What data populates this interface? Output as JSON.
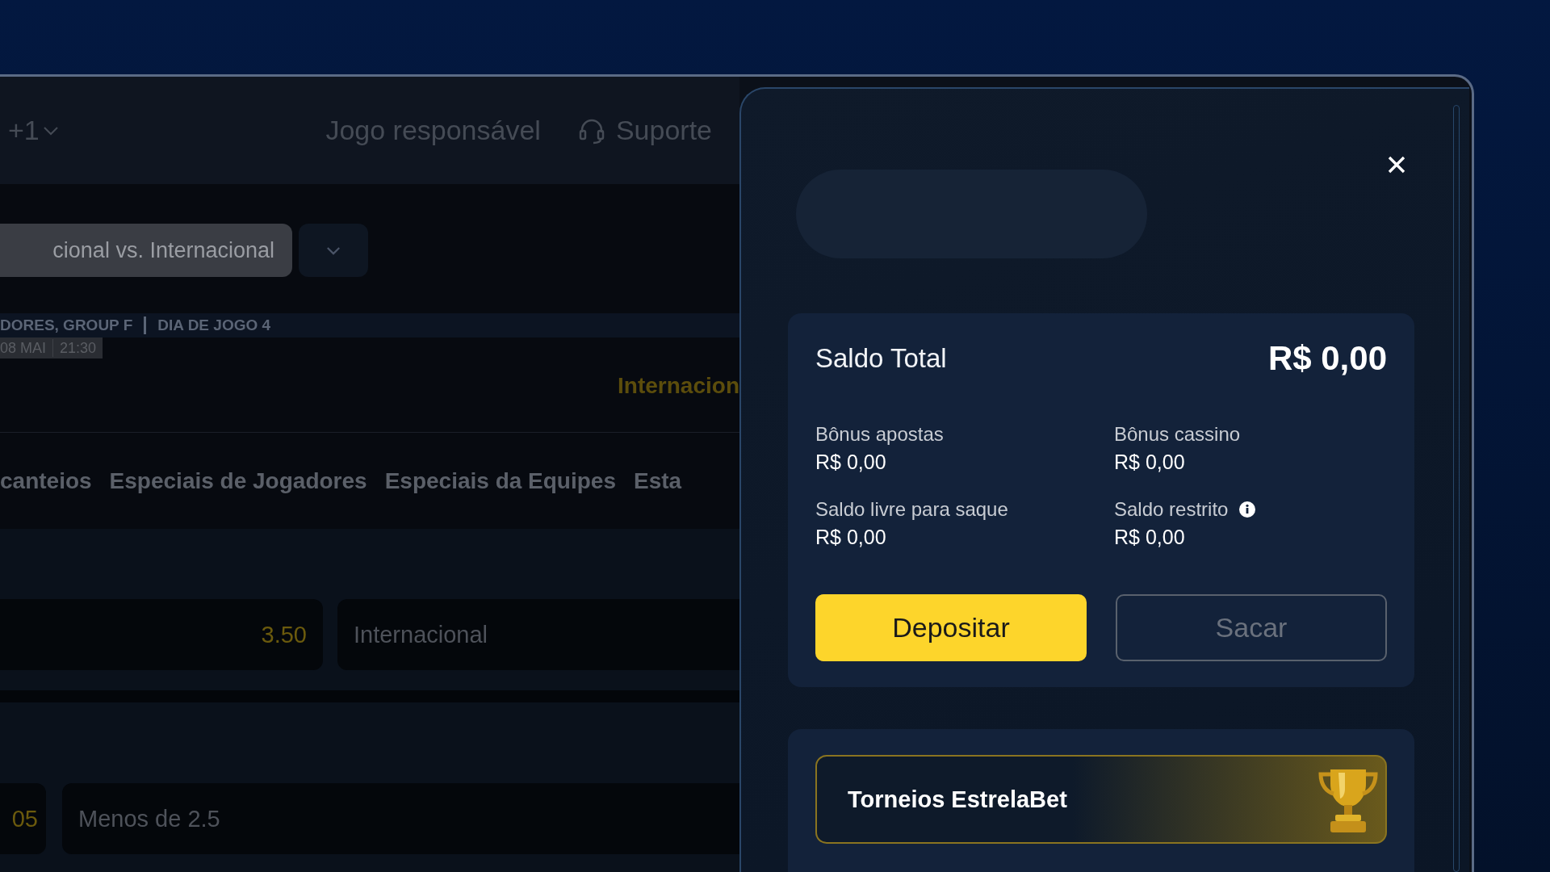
{
  "header": {
    "more_count": "+1",
    "links": [
      {
        "label": "Jogo responsável",
        "kind": "text"
      },
      {
        "label": "Suporte",
        "kind": "support"
      }
    ]
  },
  "match": {
    "selector": "cional vs. Internacional",
    "competition": "DORES, GROUP F",
    "matchday": "DIA DE JOGO  4",
    "date": "08 MAI",
    "time": "21:30",
    "team": "Internacion"
  },
  "market_tabs": [
    {
      "label": "canteios"
    },
    {
      "label": "Especiais de Jogadores"
    },
    {
      "label": "Especiais da Equipes"
    },
    {
      "label": "Esta"
    }
  ],
  "markets": [
    {
      "odds": "3.50",
      "outcome": "Internacional"
    },
    {
      "odds": "05",
      "outcome": "Menos de 2.5"
    }
  ],
  "wallet": {
    "total_label": "Saldo Total",
    "total_value": "R$ 0,00",
    "balances": [
      {
        "label": "Bônus apostas",
        "value": "R$ 0,00",
        "info": false
      },
      {
        "label": "Bônus cassino",
        "value": "R$ 0,00",
        "info": false
      },
      {
        "label": "Saldo livre para saque",
        "value": "R$ 0,00",
        "info": false
      },
      {
        "label": "Saldo restrito",
        "value": "R$ 0,00",
        "info": true
      }
    ],
    "buttons": [
      {
        "label": "Depositar",
        "kind": "primary"
      },
      {
        "label": "Sacar",
        "kind": "outline"
      }
    ]
  },
  "promo": {
    "title": "Torneios EstrelaBet"
  }
}
